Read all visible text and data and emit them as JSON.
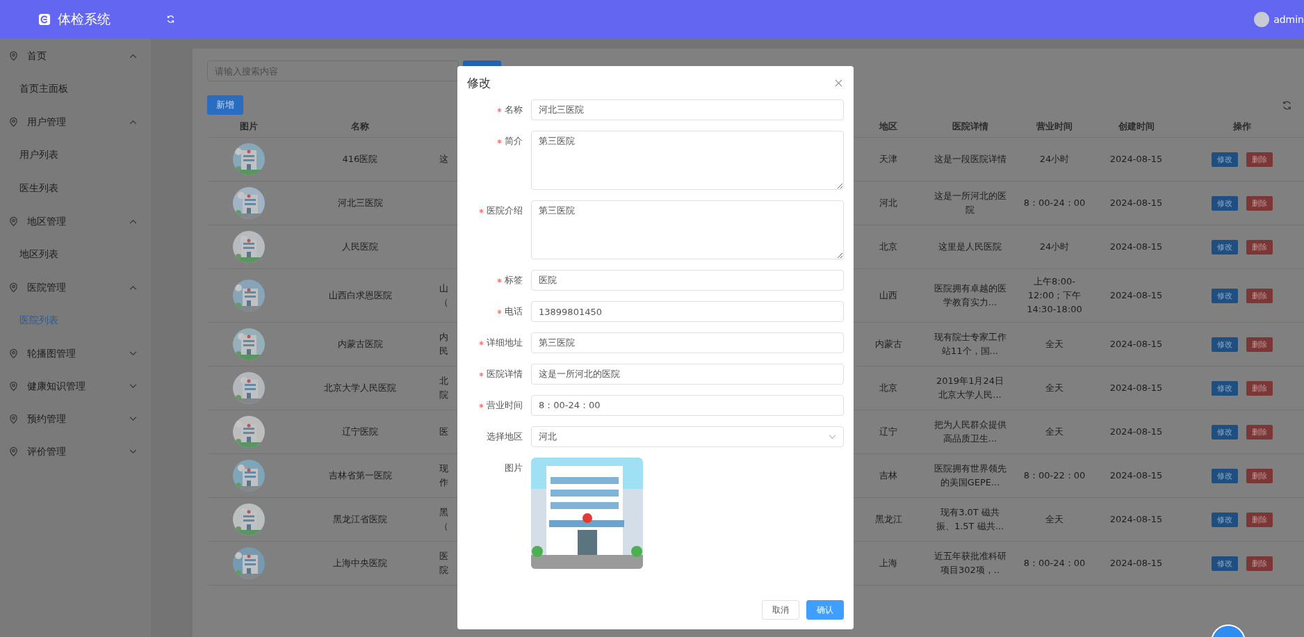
{
  "header": {
    "title": "体检系统",
    "user": "admin"
  },
  "sidebar": {
    "items": [
      {
        "label": "首页",
        "expanded": true,
        "children": [
          {
            "label": "首页主面板",
            "selected": false
          }
        ]
      },
      {
        "label": "用户管理",
        "expanded": true,
        "children": [
          {
            "label": "用户列表",
            "selected": false
          },
          {
            "label": "医生列表",
            "selected": false
          }
        ]
      },
      {
        "label": "地区管理",
        "expanded": true,
        "children": [
          {
            "label": "地区列表",
            "selected": false
          }
        ]
      },
      {
        "label": "医院管理",
        "expanded": true,
        "children": [
          {
            "label": "医院列表",
            "selected": true
          }
        ]
      },
      {
        "label": "轮播图管理",
        "expanded": false
      },
      {
        "label": "健康知识管理",
        "expanded": false
      },
      {
        "label": "预约管理",
        "expanded": false
      },
      {
        "label": "评价管理",
        "expanded": false
      }
    ]
  },
  "toolbar": {
    "search_placeholder": "请输入搜索内容",
    "add_button": "新增"
  },
  "table": {
    "columns": [
      "图片",
      "名称",
      "地区",
      "医院详情",
      "营业时间",
      "创建时间",
      "操作"
    ],
    "rows": [
      {
        "name": "416医院",
        "column_3": [
          "这"
        ],
        "region": "天津",
        "detail": "这是一段医院详情",
        "hours": "24小时",
        "created": "2024-08-15",
        "actions": [
          "修改",
          "删除"
        ]
      },
      {
        "name": "河北三医院",
        "column_3": [],
        "region": "河北",
        "detail": "这是一所河北的医院",
        "hours": "8：00-24：00",
        "created": "2024-08-15",
        "actions": [
          "修改",
          "删除"
        ]
      },
      {
        "name": "人民医院",
        "column_3": [],
        "region": "北京",
        "detail": "这里是人民医院",
        "hours": "24小时",
        "created": "2024-08-15",
        "actions": [
          "修改",
          "删除"
        ]
      },
      {
        "name": "山西白求恩医院",
        "column_3": [
          "山",
          "（"
        ],
        "region": "山西",
        "detail": "医院拥有卓越的医学教育实力...",
        "hours": "上午8:00-12:00；下午14:30-18:00",
        "created": "2024-08-15",
        "actions": [
          "修改",
          "删除"
        ]
      },
      {
        "name": "内蒙古医院",
        "column_3": [
          "内",
          "民"
        ],
        "region": "内蒙古",
        "detail": "现有院士专家工作站11个，国...",
        "hours": "全天",
        "created": "2024-08-15",
        "actions": [
          "修改",
          "删除"
        ]
      },
      {
        "name": "北京大学人民医院",
        "column_3": [
          "北",
          "院"
        ],
        "region": "北京",
        "detail": "2019年1月24日北京大学人民...",
        "hours": "全天",
        "created": "2024-08-15",
        "actions": [
          "修改",
          "删除"
        ]
      },
      {
        "name": "辽宁医院",
        "column_3": [
          "医"
        ],
        "region": "辽宁",
        "detail": "把为人民群众提供高品质卫生...",
        "hours": "全天",
        "created": "2024-08-15",
        "actions": [
          "修改",
          "删除"
        ]
      },
      {
        "name": "吉林省第一医院",
        "column_3": [
          "现",
          "作"
        ],
        "region": "吉林",
        "detail": "医院拥有世界领先的美国GEPE...",
        "hours": "8：00-22：00",
        "created": "2024-08-15",
        "actions": [
          "修改",
          "删除"
        ]
      },
      {
        "name": "黑龙江省医院",
        "column_3": [
          "黑",
          "（"
        ],
        "region": "黑龙江",
        "detail": "现有3.0T 磁共振、1.5T 磁共...",
        "hours": "全天",
        "created": "2024-08-15",
        "actions": [
          "修改",
          "删除"
        ]
      },
      {
        "name": "上海中央医院",
        "column_3": [
          "医",
          "院"
        ],
        "region": "上海",
        "detail": "近五年获批准科研项目302项，..",
        "hours": "8：00-24：00",
        "created": "2024-08-15",
        "actions": [
          "修改",
          "删除"
        ]
      }
    ]
  },
  "dialog": {
    "title": "修改",
    "fields": [
      {
        "label": "名称",
        "required": true,
        "kind": "input",
        "value": "河北三医院"
      },
      {
        "label": "简介",
        "required": true,
        "kind": "textarea",
        "value": "第三医院"
      },
      {
        "label": "医院介绍",
        "required": true,
        "kind": "textarea",
        "value": "第三医院"
      },
      {
        "label": "标签",
        "required": true,
        "kind": "input",
        "value": "医院"
      },
      {
        "label": "电话",
        "required": true,
        "kind": "input",
        "value": "13899801450"
      },
      {
        "label": "详细地址",
        "required": true,
        "kind": "input",
        "value": "第三医院"
      },
      {
        "label": "医院详情",
        "required": true,
        "kind": "input",
        "value": "这是一所河北的医院"
      },
      {
        "label": "营业时间",
        "required": true,
        "kind": "input",
        "value": "8：00-24：00"
      },
      {
        "label": "选择地区",
        "required": false,
        "kind": "select",
        "value": "河北"
      },
      {
        "label": "图片",
        "required": false
      }
    ],
    "buttons": [
      {
        "label": "取消",
        "primary": false
      },
      {
        "label": "确认",
        "primary": true
      }
    ]
  }
}
